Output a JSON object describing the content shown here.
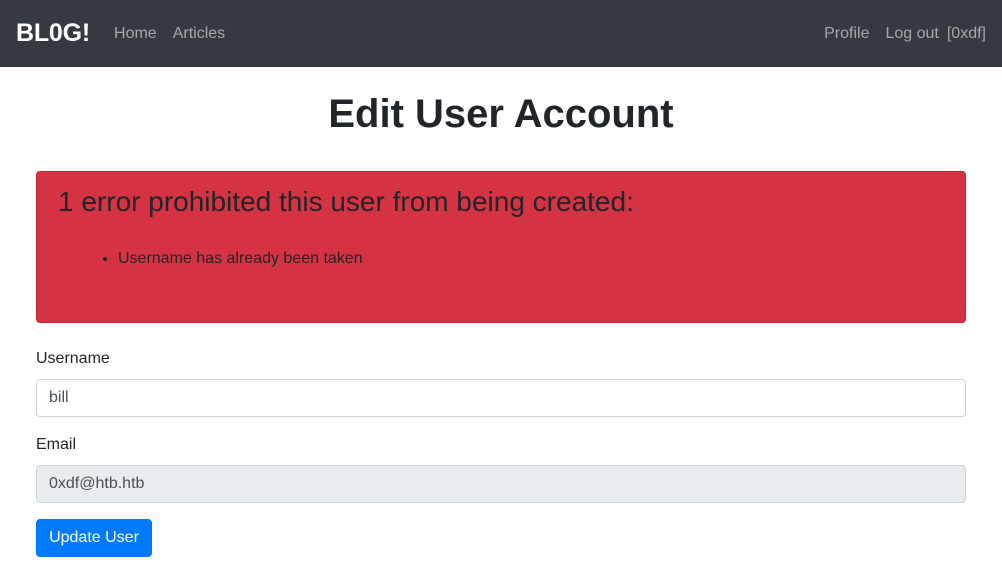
{
  "navbar": {
    "brand": "BL0G!",
    "links_left": [
      "Home",
      "Articles"
    ],
    "links_right": [
      "Profile",
      "Log out"
    ],
    "user_tag": "[0xdf]"
  },
  "page": {
    "title": "Edit User Account"
  },
  "alert": {
    "heading": "1 error prohibited this user from being created:",
    "errors": [
      "Username has already been taken"
    ],
    "color": "#d53343"
  },
  "form": {
    "username": {
      "label": "Username",
      "value": "bill"
    },
    "email": {
      "label": "Email",
      "value": "0xdf@htb.htb"
    },
    "submit_label": "Update User"
  },
  "colors": {
    "navbar_bg": "#343a40",
    "primary": "#007bff",
    "danger": "#d53343"
  }
}
